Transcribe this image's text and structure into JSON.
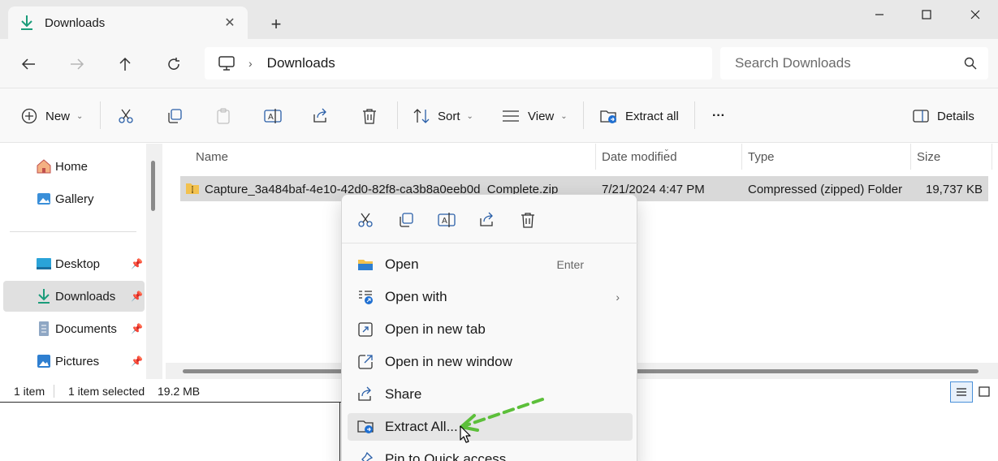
{
  "titlebar": {
    "tab_title": "Downloads",
    "new_tab": "+"
  },
  "address": {
    "crumb": "Downloads",
    "chevron": "›",
    "search_placeholder": "Search Downloads"
  },
  "toolbar": {
    "new_label": "New",
    "sort_label": "Sort",
    "view_label": "View",
    "extract_label": "Extract all",
    "more_label": "···",
    "details_label": "Details"
  },
  "sidebar": {
    "items": [
      {
        "label": "Home",
        "icon": "home-icon"
      },
      {
        "label": "Gallery",
        "icon": "gallery-icon"
      },
      {
        "label": "Desktop",
        "icon": "desktop-icon"
      },
      {
        "label": "Downloads",
        "icon": "downloads-icon"
      },
      {
        "label": "Documents",
        "icon": "documents-icon"
      },
      {
        "label": "Pictures",
        "icon": "pictures-icon"
      }
    ],
    "pin": "📌"
  },
  "filelist": {
    "columns": [
      "Name",
      "Date modified",
      "Type",
      "Size"
    ],
    "rows": [
      {
        "name": "Capture_3a484baf-4e10-42d0-82f8-ca3b8a0eeb0d_Complete.zip",
        "date": "7/21/2024 4:47 PM",
        "type": "Compressed (zipped) Folder",
        "size": "19,737 KB"
      }
    ]
  },
  "status": {
    "count": "1 item",
    "selected": "1 item selected",
    "size": "19.2 MB"
  },
  "context_menu": {
    "items": [
      {
        "label": "Open",
        "shortcut": "Enter",
        "icon": "folder-open-icon"
      },
      {
        "label": "Open with",
        "submenu": "›",
        "icon": "open-with-icon"
      },
      {
        "label": "Open in new tab",
        "icon": "new-tab-icon"
      },
      {
        "label": "Open in new window",
        "icon": "new-window-icon"
      },
      {
        "label": "Share",
        "icon": "share-icon"
      },
      {
        "label": "Extract All...",
        "icon": "extract-icon"
      },
      {
        "label": "Pin to Quick access",
        "icon": "pin-icon"
      }
    ]
  },
  "colors": {
    "accent": "#0078d4",
    "annotation_arrow": "#5cbf3a"
  }
}
